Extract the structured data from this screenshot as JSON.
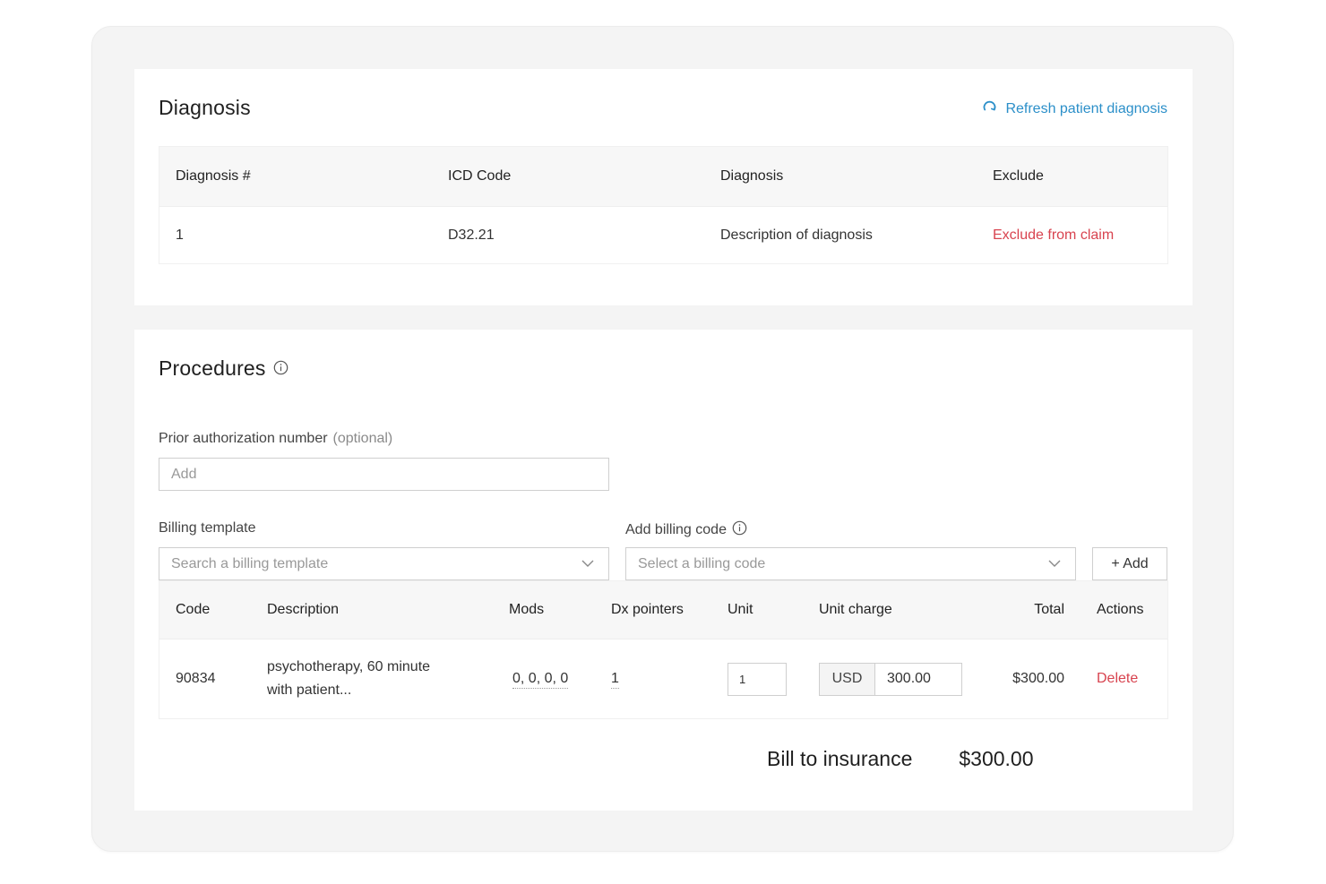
{
  "diagnosis": {
    "title": "Diagnosis",
    "refresh_label": "Refresh patient diagnosis",
    "columns": [
      "Diagnosis #",
      "ICD Code",
      "Diagnosis",
      "Exclude"
    ],
    "rows": [
      {
        "number": "1",
        "icd": "D32.21",
        "description": "Description of diagnosis",
        "action": "Exclude from claim"
      }
    ]
  },
  "procedures": {
    "title": "Procedures",
    "prior_auth_label": "Prior authorization number",
    "prior_auth_optional": "(optional)",
    "prior_auth_placeholder": "Add",
    "billing_template_label": "Billing template",
    "billing_template_placeholder": "Search a billing template",
    "billing_code_label": "Add billing code",
    "billing_code_placeholder": "Select a billing code",
    "add_button": "+ Add",
    "columns": [
      "Code",
      "Description",
      "Mods",
      "Dx pointers",
      "Unit",
      "Unit charge",
      "Total",
      "Actions"
    ],
    "rows": [
      {
        "code": "90834",
        "description_line1": "psychotherapy, 60 minute",
        "description_line2": "with patient...",
        "mods": "0, 0, 0, 0",
        "dx_pointers": "1",
        "unit": "1",
        "currency": "USD",
        "unit_charge": "300.00",
        "total": "$300.00",
        "action": "Delete"
      }
    ],
    "bill_label": "Bill to insurance",
    "bill_total": "$300.00"
  },
  "colors": {
    "accent_link": "#2b8fc9",
    "danger": "#d8434f"
  }
}
